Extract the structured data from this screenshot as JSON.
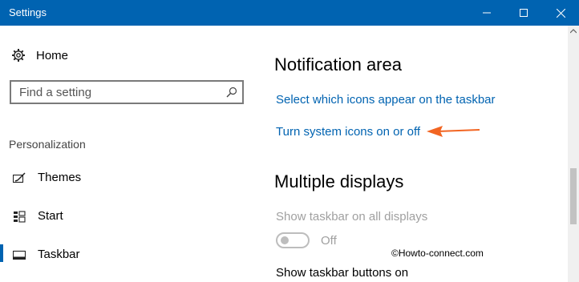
{
  "window": {
    "title": "Settings",
    "minimize_icon": "minimize-icon",
    "maximize_icon": "maximize-icon",
    "close_icon": "close-icon"
  },
  "sidebar": {
    "home": {
      "label": "Home",
      "icon": "gear-icon"
    },
    "search": {
      "placeholder": "Find a setting",
      "icon": "search-icon"
    },
    "section_title": "Personalization",
    "items": [
      {
        "label": "Themes",
        "icon": "themes-icon"
      },
      {
        "label": "Start",
        "icon": "start-icon"
      },
      {
        "label": "Taskbar",
        "icon": "taskbar-icon",
        "active": true
      }
    ]
  },
  "main": {
    "notification_area": {
      "heading": "Notification area",
      "links": [
        "Select which icons appear on the taskbar",
        "Turn system icons on or off"
      ]
    },
    "multiple_displays": {
      "heading": "Multiple displays",
      "show_taskbar_label": "Show taskbar on all displays",
      "toggle_state": "Off",
      "show_buttons_label": "Show taskbar buttons on"
    },
    "watermark": "©Howto-connect.com"
  },
  "colors": {
    "accent": "#0063b1",
    "arrow": "#f26522",
    "disabled_text": "#a0a0a0"
  }
}
